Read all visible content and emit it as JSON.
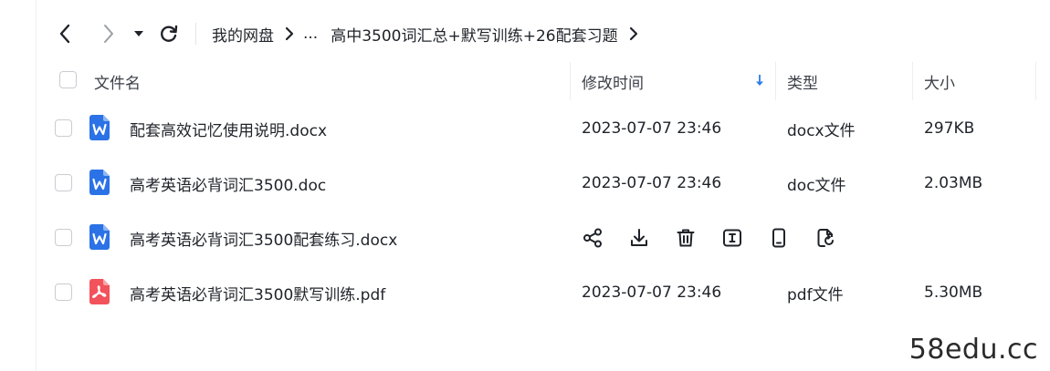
{
  "toolbar": {
    "breadcrumb": {
      "root": "我的网盘",
      "ellipsis": "...",
      "current": "高中3500词汇总+默写训练+26配套习题"
    }
  },
  "table": {
    "headers": {
      "name": "文件名",
      "modified": "修改时间",
      "type": "类型",
      "size": "大小"
    },
    "rows": [
      {
        "name": "配套高效记忆使用说明.docx",
        "icon": "word-doc-icon",
        "modified": "2023-07-07 23:46",
        "type": "docx文件",
        "size": "297KB"
      },
      {
        "name": "高考英语必背词汇3500.doc",
        "icon": "word-doc-icon",
        "modified": "2023-07-07 23:46",
        "type": "doc文件",
        "size": "2.03MB"
      },
      {
        "name": "高考英语必背词汇3500配套练习.docx",
        "icon": "word-doc-icon",
        "hovered": true,
        "actions": [
          "share-icon",
          "download-icon",
          "delete-icon",
          "rename-icon",
          "mobile-icon",
          "copy-icon"
        ]
      },
      {
        "name": "高考英语必背词汇3500默写训练.pdf",
        "icon": "pdf-icon",
        "modified": "2023-07-07 23:46",
        "type": "pdf文件",
        "size": "5.30MB"
      }
    ]
  },
  "colors": {
    "word_blue": "#2b72e6",
    "pdf_red": "#f2525b",
    "sort_arrow": "#2b7de9"
  },
  "watermark": "58edu.cc"
}
